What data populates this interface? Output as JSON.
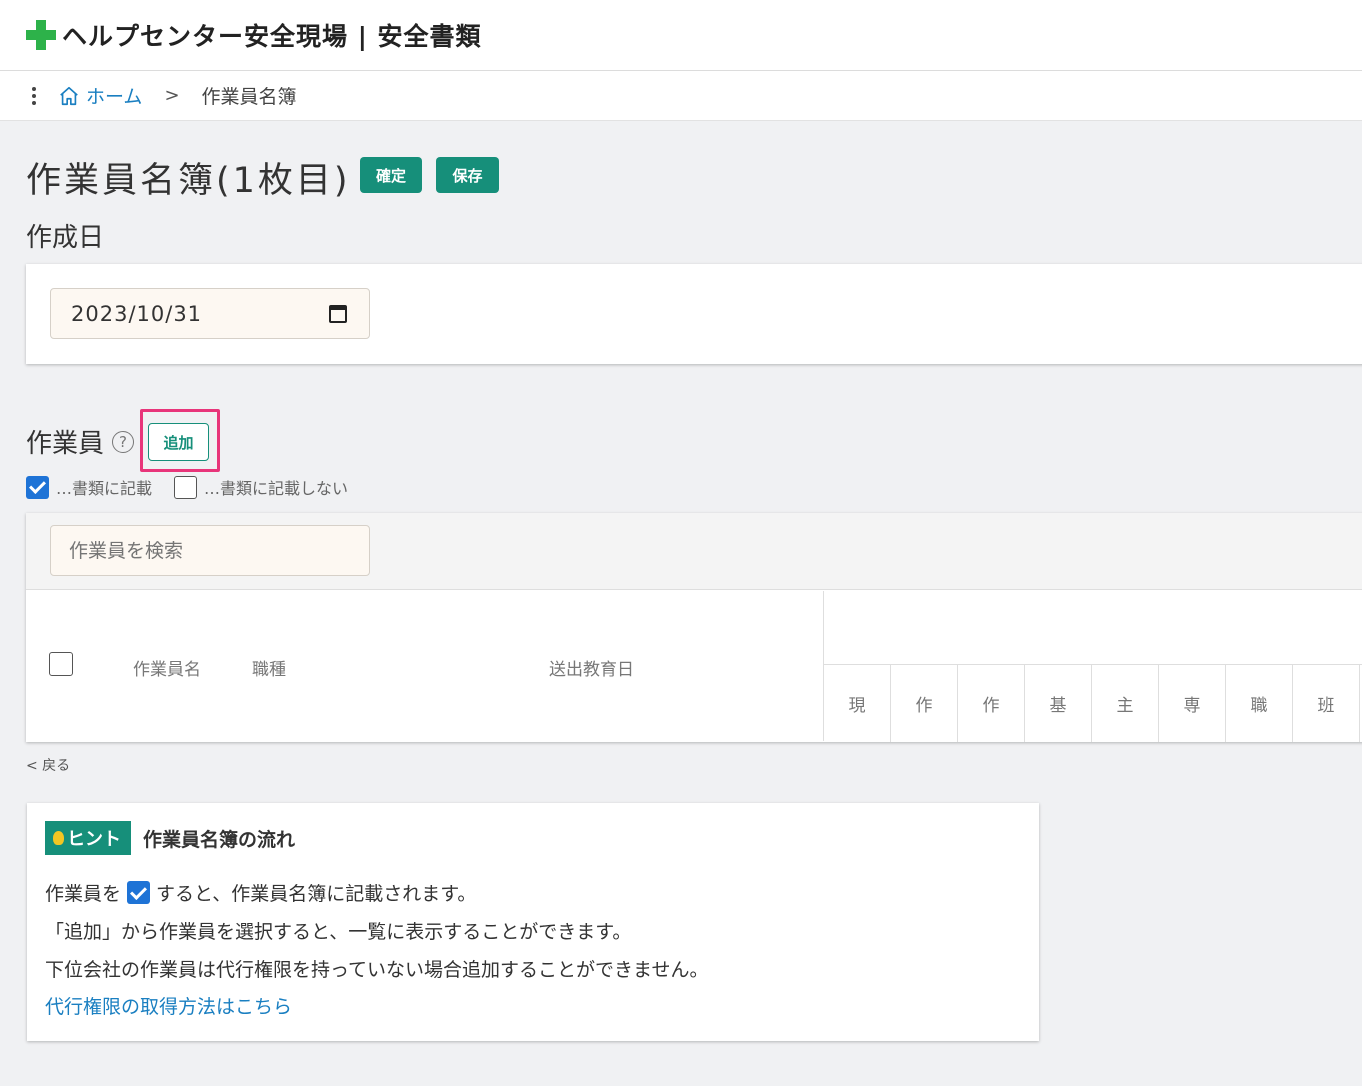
{
  "header": {
    "title": "ヘルプセンター安全現場 | 安全書類"
  },
  "breadcrumb": {
    "home": "ホーム",
    "separator": ">",
    "current": "作業員名簿"
  },
  "page": {
    "title": "作業員名簿(1枚目)",
    "confirm_label": "確定",
    "save_label": "保存"
  },
  "date_section": {
    "label": "作成日",
    "value": "2023/10/31"
  },
  "worker_section": {
    "label": "作業員",
    "help": "?",
    "add_label": "追加",
    "check_included": {
      "label": "…書類に記載",
      "checked": true
    },
    "check_excluded": {
      "label": "…書類に記載しない",
      "checked": false
    },
    "search_placeholder": "作業員を検索",
    "columns": {
      "name": "作業員名",
      "job": "職種",
      "education_date": "送出教育日"
    },
    "qualification_columns": [
      "現",
      "作",
      "作",
      "基",
      "主",
      "専",
      "職",
      "班"
    ]
  },
  "back_link": "< 戻る",
  "hint": {
    "badge": "ヒント",
    "title": "作業員名簿の流れ",
    "line1_before": "作業員を",
    "line1_after": "すると、作業員名簿に記載されます。",
    "line2": "「追加」から作業員を選択すると、一覧に表示することができます。",
    "line3": "下位会社の作業員は代行権限を持っていない場合追加することができません。",
    "link": "代行権限の取得方法はこちら"
  },
  "colors": {
    "brand_green": "#2db24a",
    "teal": "#168f7a",
    "link_blue": "#1a7fc1",
    "highlight_pink": "#e8357a",
    "check_blue": "#1e73d6"
  }
}
